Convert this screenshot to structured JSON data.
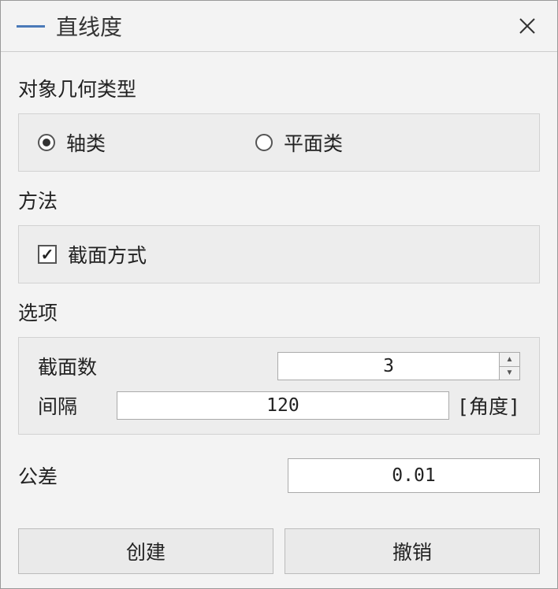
{
  "title": "直线度",
  "sections": {
    "geometry_type": {
      "label": "对象几何类型",
      "options": {
        "axis": {
          "label": "轴类",
          "selected": true
        },
        "plane": {
          "label": "平面类",
          "selected": false
        }
      }
    },
    "method": {
      "label": "方法",
      "checkbox": {
        "label": "截面方式",
        "checked": true
      }
    },
    "options": {
      "label": "选项",
      "section_count": {
        "label": "截面数",
        "value": "3"
      },
      "interval": {
        "label": "间隔",
        "value": "120",
        "unit": "[角度]"
      }
    },
    "tolerance": {
      "label": "公差",
      "value": "0.01"
    }
  },
  "buttons": {
    "create": "创建",
    "cancel": "撤销"
  }
}
